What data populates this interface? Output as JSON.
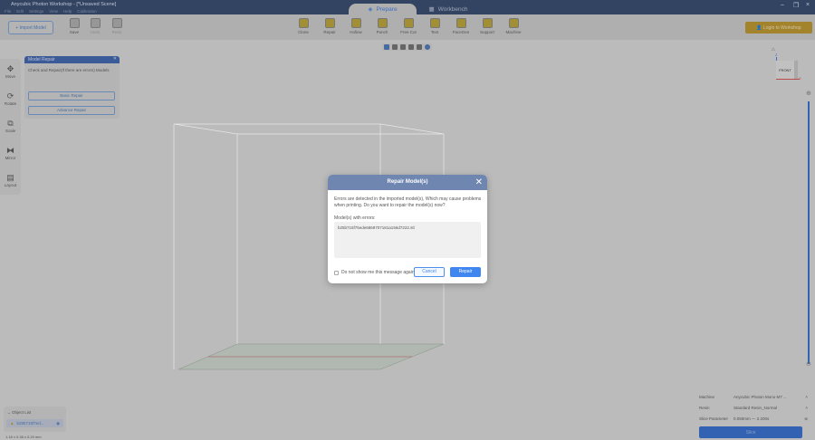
{
  "window": {
    "title": "Anycubic Photon Workshop - [*Unsaved Scene]",
    "menu": [
      "File",
      "Edit",
      "Settings",
      "View",
      "Help",
      "Calibration"
    ]
  },
  "tabs": [
    {
      "label": "Prepare",
      "active": true
    },
    {
      "label": "Workbench",
      "active": false
    }
  ],
  "toolbar": {
    "import": "+ Import Model",
    "save": "Save",
    "undo": "Undo",
    "redo": "Redo",
    "tools": [
      "Clone",
      "Repair",
      "Hollow",
      "Punch",
      "Free Cut",
      "Text",
      "FaceGen",
      "Support",
      "Machine"
    ],
    "login": "Login to Workshop"
  },
  "left_tools": [
    "Move",
    "Rotate",
    "Scale",
    "Mirror",
    "Layout"
  ],
  "repair_panel": {
    "title": "Model Repair",
    "desc": "Check and Repair(If there are errors) Models",
    "basic": "Basic Repair",
    "advance": "Advance Repair"
  },
  "view_cube": {
    "face": "FRONT",
    "axis_z": "Z",
    "axis_x": "X"
  },
  "object_list": {
    "title": "Object List",
    "item": "b25b715f7ed...",
    "size": "1.18 x 0.36 x 0.20 mm"
  },
  "right_panel": {
    "machine_label": "Machine",
    "machine_value": "Anycubic Photon Mono M7 ...",
    "resin_label": "Resin",
    "resin_value": "Standard Resin_Normal",
    "param_label": "Slice Parameter",
    "param_value": "0.050mm  —  2.200s",
    "slice": "Slice"
  },
  "dialog": {
    "title": "Repair Model(s)",
    "message": "Errors are detected in the imported model(s), Which may cause problems when printing. Do you want to repair the model(s) now?",
    "list_label": "Model(s) with errors:",
    "files": [
      "b25b715f75ede6869707181a156d7222.stl"
    ],
    "checkbox": "Do not show me this message again",
    "cancel": "Cancel",
    "repair": "Repair"
  }
}
